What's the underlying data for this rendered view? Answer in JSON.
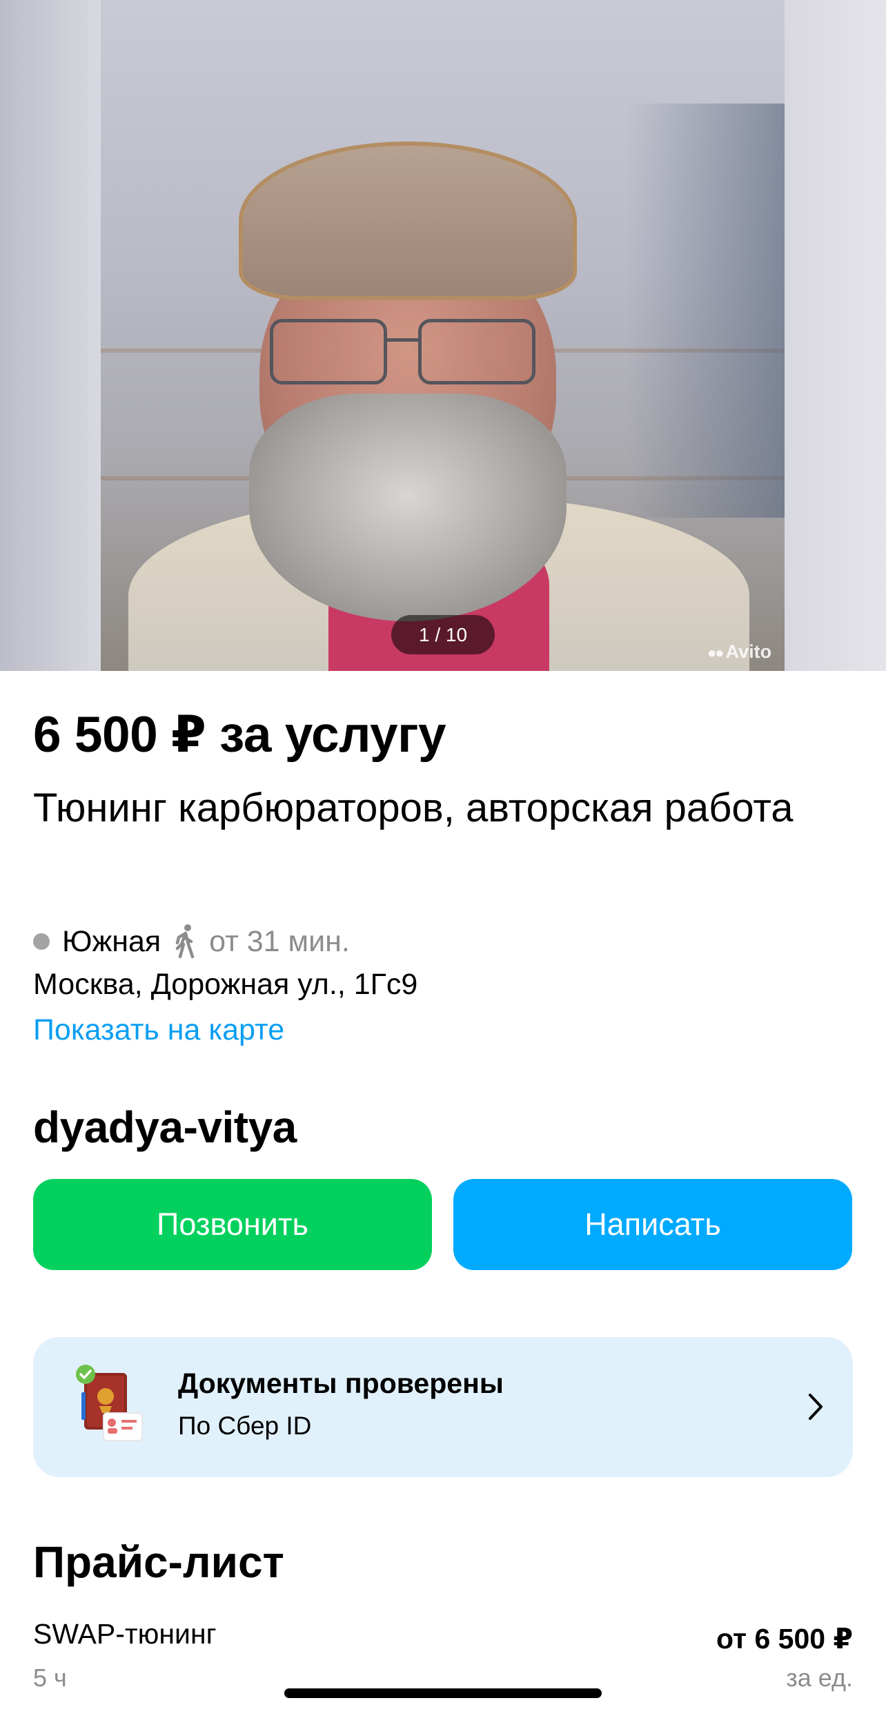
{
  "gallery": {
    "counter": "1 / 10",
    "watermark": "Avito"
  },
  "listing": {
    "price": "6 500 ₽ за услугу",
    "title": "Тюнинг карбюраторов, авторская работа"
  },
  "location": {
    "metro_station": "Южная",
    "metro_color": "#a3a3a3",
    "walk_time": "от 31 мин.",
    "address": "Москва, Дорожная ул., 1Гс9",
    "map_link": "Показать на карте"
  },
  "seller": {
    "name": "dyadya-vitya"
  },
  "actions": {
    "call_label": "Позвонить",
    "call_color": "#04d15d",
    "write_label": "Написать",
    "write_color": "#00aaff"
  },
  "verification": {
    "title": "Документы проверены",
    "subtitle": "По Сбер ID",
    "icon": "passport-verified-icon"
  },
  "price_list": {
    "heading": "Прайс-лист",
    "items": [
      {
        "name": "SWAP-тюнинг",
        "duration": "5 ч",
        "price": "от 6 500 ₽",
        "unit": "за ед."
      }
    ]
  }
}
